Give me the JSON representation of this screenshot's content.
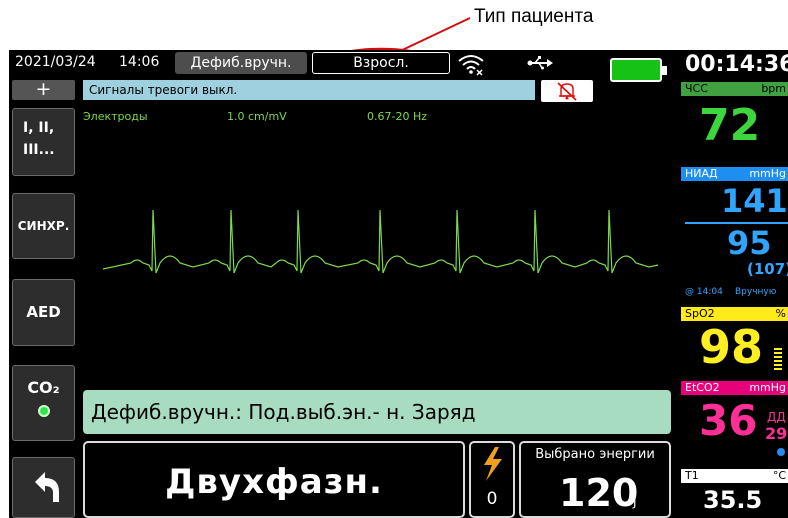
{
  "annotation": {
    "label": "Тип пациента"
  },
  "topbar": {
    "date": "2021/03/24",
    "time": "14:06",
    "mode": "Дефиб.вручн.",
    "patient_type": "Взросл."
  },
  "alarm": {
    "text": "Сигналы тревоги выкл."
  },
  "softkeys": {
    "plus": "+",
    "leads": [
      "I, II,",
      "III..."
    ],
    "sync": "СИНХР.",
    "aed": "AED",
    "co2": "CO₂"
  },
  "ecg": {
    "source": "Электроды",
    "gain": "1.0 cm/mV",
    "filter": "0.67-20 Hz"
  },
  "message": {
    "text": "Дефиб.вручн.: Под.выб.эн.- н. Заряд"
  },
  "energy": {
    "waveform": "Двухфазн.",
    "charge_count": "0",
    "selected_label": "Выбрано энергии",
    "selected_value": "120",
    "unit": "J"
  },
  "vitals": {
    "clock": "00:14:36",
    "hr": {
      "label": "ЧСС",
      "unit": "bpm",
      "value": "72"
    },
    "nibp": {
      "label": "НИАД",
      "unit": "mmHg",
      "sys": "141",
      "dia": "95",
      "map": "(107)",
      "time": "@ 14:04",
      "mode": "Вручную"
    },
    "spo2": {
      "label": "SpO2",
      "unit": "%",
      "value": "98"
    },
    "etco2": {
      "label": "EtCO2",
      "unit": "mmHg",
      "value": "36",
      "rr_label": "ДД",
      "rr_value": "29"
    },
    "temp": {
      "label": "T1",
      "unit": "°C",
      "value": "35.5"
    }
  },
  "colors": {
    "ecg": "#7ed94d",
    "hr": "#3dd63d",
    "nibp": "#2fa5ff",
    "spo2": "#ffee22",
    "etco2": "#ff2f97",
    "message_bg": "#a7dcc0",
    "alarm_bg": "#9ed0df",
    "battery": "#16c216"
  }
}
